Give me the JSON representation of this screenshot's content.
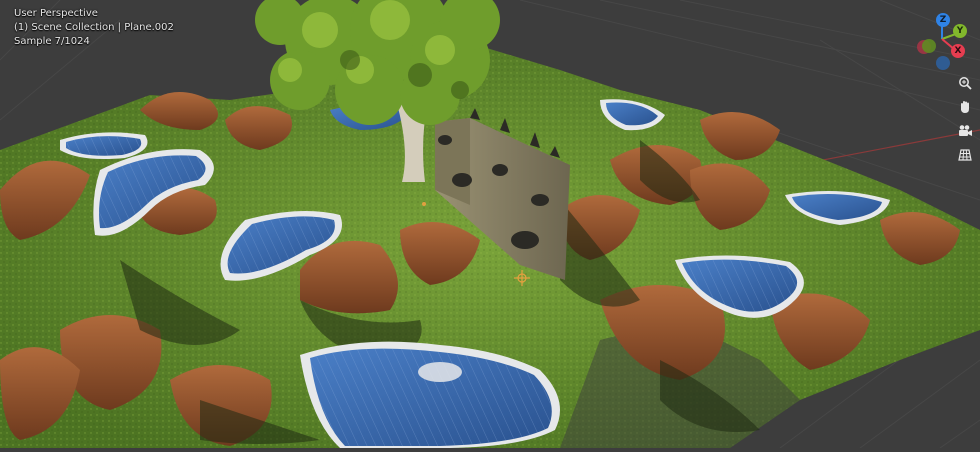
{
  "viewport": {
    "info": {
      "perspective": "User Perspective",
      "collection": "(1) Scene Collection | Plane.002",
      "sample": "Sample 7/1024"
    }
  },
  "gizmo": {
    "axes": [
      {
        "label": "Z",
        "color": "#2f83e6"
      },
      {
        "label": "Y",
        "color": "#82b82c"
      },
      {
        "label": "X",
        "color": "#e63d50"
      }
    ],
    "negative_axes": [
      {
        "name": "-x",
        "color": "#a83445"
      },
      {
        "name": "-y",
        "color": "#5f8b22"
      },
      {
        "name": "-z",
        "color": "#2d5f9c"
      }
    ]
  },
  "navigation": {
    "buttons": [
      {
        "name": "zoom-icon"
      },
      {
        "name": "hand-pan-icon"
      },
      {
        "name": "camera-icon"
      },
      {
        "name": "grid-icon"
      }
    ]
  },
  "colors": {
    "background": "#3d3d3d",
    "grass": "#5f8c2a",
    "dirt": "#8a4a2a",
    "water": "#3f6fb5",
    "foam": "#d8dde2",
    "stone": "#8c8466",
    "foliage": "#6f9d2c",
    "trunk": "#d4cdbb"
  }
}
